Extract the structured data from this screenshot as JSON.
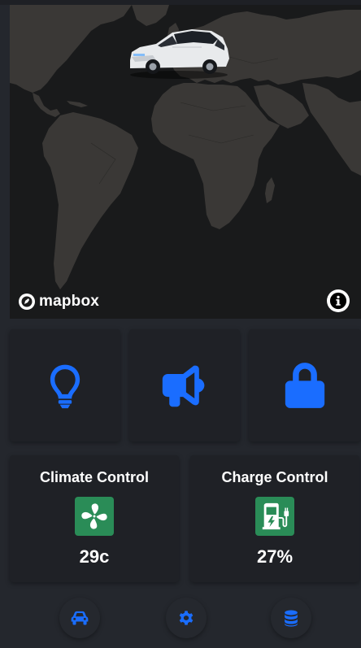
{
  "map": {
    "attribution_logo": "mapbox",
    "info_icon": "info-icon",
    "vehicle_marker": "car-image"
  },
  "quick_actions": [
    {
      "icon": "lightbulb-icon",
      "color": "#1a6dff"
    },
    {
      "icon": "megaphone-icon",
      "color": "#1a6dff"
    },
    {
      "icon": "lock-icon",
      "color": "#1a6dff"
    }
  ],
  "climate": {
    "title": "Climate Control",
    "value": "29c",
    "icon": "fan-icon",
    "icon_bg": "#2a8c57"
  },
  "charge": {
    "title": "Charge Control",
    "value": "27%",
    "icon": "charging-station-icon",
    "icon_bg": "#2a8c57"
  },
  "bottom_nav": [
    {
      "icon": "car-icon"
    },
    {
      "icon": "gear-icon"
    },
    {
      "icon": "database-icon"
    }
  ],
  "colors": {
    "accent": "#1a6dff",
    "background": "#24272d",
    "card": "#1f2126",
    "map_water": "#191a1b",
    "map_land": "#3a3836"
  }
}
